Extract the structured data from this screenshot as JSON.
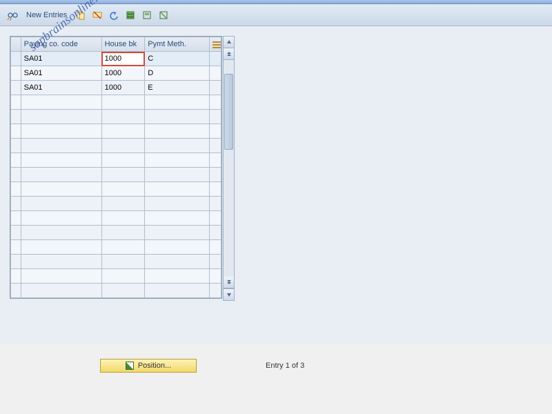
{
  "toolbar": {
    "new_entries_label": "New Entries"
  },
  "table": {
    "columns": [
      "Paying co. code",
      "House bk",
      "Pymt Meth."
    ],
    "rows": [
      {
        "paying_co_code": "SA01",
        "house_bk": "1000",
        "pymt_meth": "C",
        "house_bk_selected": true
      },
      {
        "paying_co_code": "SA01",
        "house_bk": "1000",
        "pymt_meth": "D"
      },
      {
        "paying_co_code": "SA01",
        "house_bk": "1000",
        "pymt_meth": "E"
      }
    ],
    "empty_rows": 14
  },
  "footer": {
    "position_label": "Position...",
    "entry_status": "Entry 1 of 3"
  },
  "watermark_text": "sapbrainsonline.com"
}
